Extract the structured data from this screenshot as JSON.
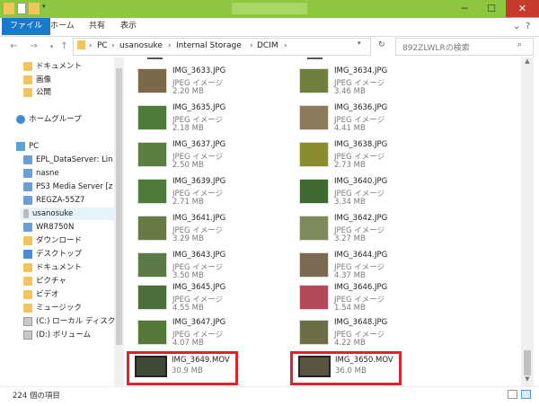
{
  "ribbon": {
    "tabs": [
      {
        "label": "ファイル"
      },
      {
        "label": "ホーム"
      },
      {
        "label": "共有"
      },
      {
        "label": "表示"
      }
    ]
  },
  "address": {
    "crumbs": [
      "PC",
      "usanosuke",
      "Internal Storage",
      "DCIM"
    ]
  },
  "search": {
    "placeholder": "892ZLWLRの検索"
  },
  "nav": {
    "items": [
      {
        "label": "ドキュメント",
        "icon": "folder-icon"
      },
      {
        "label": "画像",
        "icon": "folder-icon"
      },
      {
        "label": "公開",
        "icon": "folder-icon"
      },
      {
        "label": "ホームグループ",
        "icon": "homegroup-icon"
      },
      {
        "label": "PC",
        "icon": "pc-icon"
      },
      {
        "label": "EPL_DataServer: Lin",
        "icon": "network-device-icon"
      },
      {
        "label": "nasne",
        "icon": "network-device-icon"
      },
      {
        "label": "PS3 Media Server [z",
        "icon": "network-device-icon"
      },
      {
        "label": "REGZA-55Z7",
        "icon": "network-device-icon"
      },
      {
        "label": "usanosuke",
        "icon": "phone-icon"
      },
      {
        "label": "WR8750N",
        "icon": "network-device-icon"
      },
      {
        "label": "ダウンロード",
        "icon": "download-folder-icon"
      },
      {
        "label": "デスクトップ",
        "icon": "desktop-folder-icon"
      },
      {
        "label": "ドキュメント",
        "icon": "documents-folder-icon"
      },
      {
        "label": "ピクチャ",
        "icon": "pictures-folder-icon"
      },
      {
        "label": "ビデオ",
        "icon": "videos-folder-icon"
      },
      {
        "label": "ミュージック",
        "icon": "music-folder-icon"
      },
      {
        "label": "(C:) ローカル ディスク",
        "icon": "drive-icon"
      },
      {
        "label": "(D:) ボリューム",
        "icon": "drive-icon"
      }
    ]
  },
  "files": [
    {
      "name": "IMG_3633.JPG",
      "type": "JPEG イメージ",
      "size": "2.20 MB",
      "color": "#7b6a4a"
    },
    {
      "name": "IMG_3634.JPG",
      "type": "JPEG イメージ",
      "size": "3.46 MB",
      "color": "#6f7f3e"
    },
    {
      "name": "IMG_3635.JPG",
      "type": "JPEG イメージ",
      "size": "2.18 MB",
      "color": "#4e7a3a"
    },
    {
      "name": "IMG_3636.JPG",
      "type": "JPEG イメージ",
      "size": "4.41 MB",
      "color": "#8b7d5b"
    },
    {
      "name": "IMG_3637.JPG",
      "type": "JPEG イメージ",
      "size": "2.50 MB",
      "color": "#5a7f40"
    },
    {
      "name": "IMG_3638.JPG",
      "type": "JPEG イメージ",
      "size": "2.73 MB",
      "color": "#8a8a2e"
    },
    {
      "name": "IMG_3639.JPG",
      "type": "JPEG イメージ",
      "size": "2.71 MB",
      "color": "#4f7a3a"
    },
    {
      "name": "IMG_3640.JPG",
      "type": "JPEG イメージ",
      "size": "3.34 MB",
      "color": "#3d6a30"
    },
    {
      "name": "IMG_3641.JPG",
      "type": "JPEG イメージ",
      "size": "3.29 MB",
      "color": "#6a7a44"
    },
    {
      "name": "IMG_3642.JPG",
      "type": "JPEG イメージ",
      "size": "3.27 MB",
      "color": "#7d8a5a"
    },
    {
      "name": "IMG_3643.JPG",
      "type": "JPEG イメージ",
      "size": "3.50 MB",
      "color": "#5b7a48"
    },
    {
      "name": "IMG_3644.JPG",
      "type": "JPEG イメージ",
      "size": "4.37 MB",
      "color": "#7a6a52"
    },
    {
      "name": "IMG_3645.JPG",
      "type": "JPEG イメージ",
      "size": "4.55 MB",
      "color": "#4d6e3a"
    },
    {
      "name": "IMG_3646.JPG",
      "type": "JPEG イメージ",
      "size": "1.54 MB",
      "color": "#b34a5a"
    },
    {
      "name": "IMG_3647.JPG",
      "type": "JPEG イメージ",
      "size": "4.07 MB",
      "color": "#567838"
    },
    {
      "name": "IMG_3648.JPG",
      "type": "JPEG イメージ",
      "size": "4.22 MB",
      "color": "#6c6f45"
    },
    {
      "name": "IMG_3649.MOV",
      "type": "",
      "size": "30.9 MB",
      "color": "#3e4a35"
    },
    {
      "name": "IMG_3650.MOV",
      "type": "",
      "size": "36.0 MB",
      "color": "#5a5440"
    }
  ],
  "status": {
    "count": "224 個の項目"
  },
  "colors": {
    "highlight": "#e0232a",
    "titlebar": "#8dc63f",
    "file_tab": "#1979ca"
  }
}
